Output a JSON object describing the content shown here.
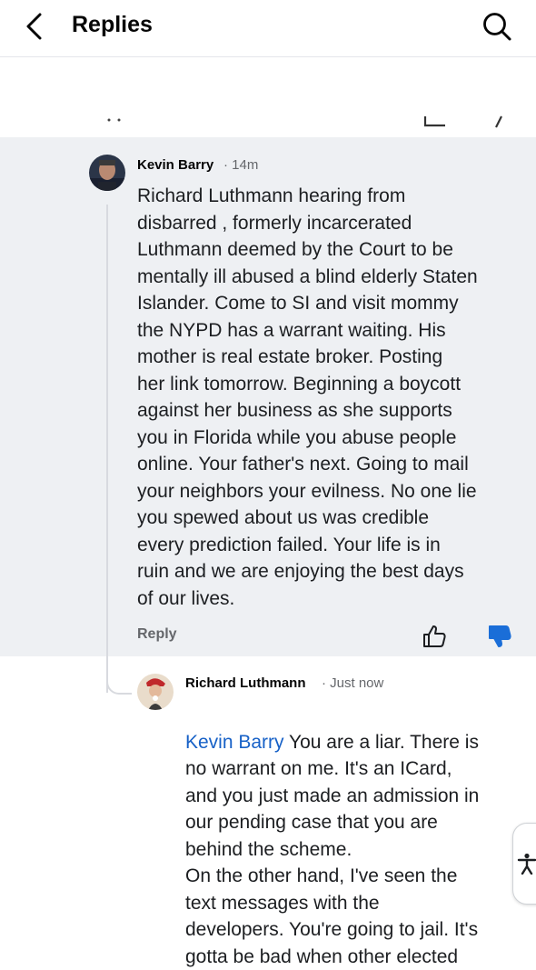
{
  "header": {
    "title": "Replies",
    "back_icon": "chevron-left-icon",
    "search_icon": "search-icon"
  },
  "comment": {
    "author": "Kevin Barry",
    "time": "· 14m",
    "text": "Richard Luthmann hearing from\ndisbarred , formerly incarcerated\nLuthmann deemed by the Court to be\nmentally ill abused a blind elderly Staten\nIslander. Come to SI and visit mommy\nthe NYPD has a warrant waiting. His\nmother  is real estate broker. Posting\nher link tomorrow. Beginning a boycott\nagainst her business as she supports\nyou in Florida while you abuse people\nonline. Your father's next. Going to mail\nyour neighbors your evilness. No one lie\nyou spewed about us was credible\nevery prediction failed. Your life is in\nruin and we are enjoying the best days\nof our lives.",
    "reply_label": "Reply",
    "like_icon": "thumbs-up-icon",
    "dislike_icon": "thumbs-down-icon",
    "dislike_color": "#1a6ed8"
  },
  "reply": {
    "author": "Richard Luthmann",
    "time": "· Just now",
    "mention": "Kevin Barry",
    "text_after_mention": " You are a liar. There is\nno warrant on me. It's an ICard,\nand you just made an admission in\nour pending case that you are\nbehind the scheme.\nOn the other hand, I've seen the\ntext messages with the\ndevelopers. You're going to jail. It's\ngotta be bad when other elected",
    "mention_color": "#1761c7"
  },
  "accessibility_icon": "accessibility-icon"
}
